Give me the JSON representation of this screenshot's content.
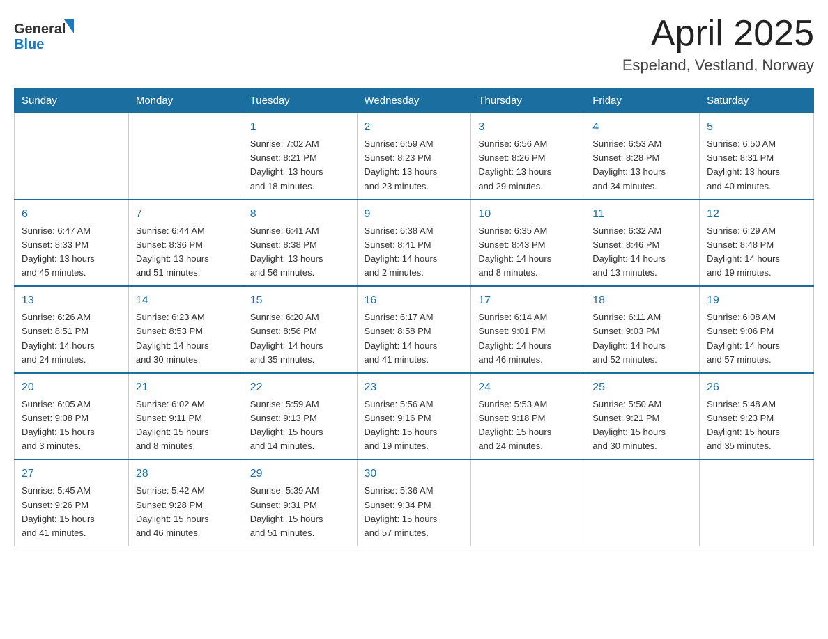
{
  "logo": {
    "general": "General",
    "blue": "Blue"
  },
  "title": "April 2025",
  "location": "Espeland, Vestland, Norway",
  "headers": [
    "Sunday",
    "Monday",
    "Tuesday",
    "Wednesday",
    "Thursday",
    "Friday",
    "Saturday"
  ],
  "weeks": [
    [
      {
        "day": "",
        "info": ""
      },
      {
        "day": "",
        "info": ""
      },
      {
        "day": "1",
        "info": "Sunrise: 7:02 AM\nSunset: 8:21 PM\nDaylight: 13 hours\nand 18 minutes."
      },
      {
        "day": "2",
        "info": "Sunrise: 6:59 AM\nSunset: 8:23 PM\nDaylight: 13 hours\nand 23 minutes."
      },
      {
        "day": "3",
        "info": "Sunrise: 6:56 AM\nSunset: 8:26 PM\nDaylight: 13 hours\nand 29 minutes."
      },
      {
        "day": "4",
        "info": "Sunrise: 6:53 AM\nSunset: 8:28 PM\nDaylight: 13 hours\nand 34 minutes."
      },
      {
        "day": "5",
        "info": "Sunrise: 6:50 AM\nSunset: 8:31 PM\nDaylight: 13 hours\nand 40 minutes."
      }
    ],
    [
      {
        "day": "6",
        "info": "Sunrise: 6:47 AM\nSunset: 8:33 PM\nDaylight: 13 hours\nand 45 minutes."
      },
      {
        "day": "7",
        "info": "Sunrise: 6:44 AM\nSunset: 8:36 PM\nDaylight: 13 hours\nand 51 minutes."
      },
      {
        "day": "8",
        "info": "Sunrise: 6:41 AM\nSunset: 8:38 PM\nDaylight: 13 hours\nand 56 minutes."
      },
      {
        "day": "9",
        "info": "Sunrise: 6:38 AM\nSunset: 8:41 PM\nDaylight: 14 hours\nand 2 minutes."
      },
      {
        "day": "10",
        "info": "Sunrise: 6:35 AM\nSunset: 8:43 PM\nDaylight: 14 hours\nand 8 minutes."
      },
      {
        "day": "11",
        "info": "Sunrise: 6:32 AM\nSunset: 8:46 PM\nDaylight: 14 hours\nand 13 minutes."
      },
      {
        "day": "12",
        "info": "Sunrise: 6:29 AM\nSunset: 8:48 PM\nDaylight: 14 hours\nand 19 minutes."
      }
    ],
    [
      {
        "day": "13",
        "info": "Sunrise: 6:26 AM\nSunset: 8:51 PM\nDaylight: 14 hours\nand 24 minutes."
      },
      {
        "day": "14",
        "info": "Sunrise: 6:23 AM\nSunset: 8:53 PM\nDaylight: 14 hours\nand 30 minutes."
      },
      {
        "day": "15",
        "info": "Sunrise: 6:20 AM\nSunset: 8:56 PM\nDaylight: 14 hours\nand 35 minutes."
      },
      {
        "day": "16",
        "info": "Sunrise: 6:17 AM\nSunset: 8:58 PM\nDaylight: 14 hours\nand 41 minutes."
      },
      {
        "day": "17",
        "info": "Sunrise: 6:14 AM\nSunset: 9:01 PM\nDaylight: 14 hours\nand 46 minutes."
      },
      {
        "day": "18",
        "info": "Sunrise: 6:11 AM\nSunset: 9:03 PM\nDaylight: 14 hours\nand 52 minutes."
      },
      {
        "day": "19",
        "info": "Sunrise: 6:08 AM\nSunset: 9:06 PM\nDaylight: 14 hours\nand 57 minutes."
      }
    ],
    [
      {
        "day": "20",
        "info": "Sunrise: 6:05 AM\nSunset: 9:08 PM\nDaylight: 15 hours\nand 3 minutes."
      },
      {
        "day": "21",
        "info": "Sunrise: 6:02 AM\nSunset: 9:11 PM\nDaylight: 15 hours\nand 8 minutes."
      },
      {
        "day": "22",
        "info": "Sunrise: 5:59 AM\nSunset: 9:13 PM\nDaylight: 15 hours\nand 14 minutes."
      },
      {
        "day": "23",
        "info": "Sunrise: 5:56 AM\nSunset: 9:16 PM\nDaylight: 15 hours\nand 19 minutes."
      },
      {
        "day": "24",
        "info": "Sunrise: 5:53 AM\nSunset: 9:18 PM\nDaylight: 15 hours\nand 24 minutes."
      },
      {
        "day": "25",
        "info": "Sunrise: 5:50 AM\nSunset: 9:21 PM\nDaylight: 15 hours\nand 30 minutes."
      },
      {
        "day": "26",
        "info": "Sunrise: 5:48 AM\nSunset: 9:23 PM\nDaylight: 15 hours\nand 35 minutes."
      }
    ],
    [
      {
        "day": "27",
        "info": "Sunrise: 5:45 AM\nSunset: 9:26 PM\nDaylight: 15 hours\nand 41 minutes."
      },
      {
        "day": "28",
        "info": "Sunrise: 5:42 AM\nSunset: 9:28 PM\nDaylight: 15 hours\nand 46 minutes."
      },
      {
        "day": "29",
        "info": "Sunrise: 5:39 AM\nSunset: 9:31 PM\nDaylight: 15 hours\nand 51 minutes."
      },
      {
        "day": "30",
        "info": "Sunrise: 5:36 AM\nSunset: 9:34 PM\nDaylight: 15 hours\nand 57 minutes."
      },
      {
        "day": "",
        "info": ""
      },
      {
        "day": "",
        "info": ""
      },
      {
        "day": "",
        "info": ""
      }
    ]
  ]
}
